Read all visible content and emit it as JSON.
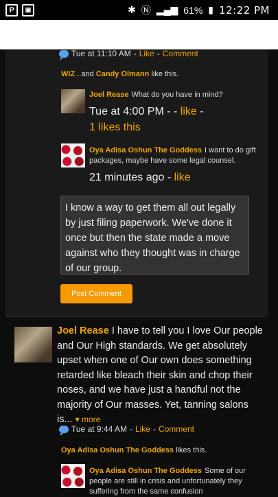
{
  "status_bar": {
    "time": "12:22 PM",
    "battery": "61%"
  },
  "comment_thread": {
    "post_meta": {
      "time": "Tue at 11:10 AM",
      "sep1": "-",
      "like": "Like",
      "sep2": "-",
      "comment": "Comment"
    },
    "post_likes": {
      "user1": "WIZ .",
      "and": "and",
      "user2": "Candy Olmann",
      "suffix": "like this."
    },
    "reply1": {
      "author": "Joel Rease",
      "text": "What do you have in mind?",
      "time": "Tue at 4:00 PM - - ",
      "like": "like",
      "likes_count": "1 likes this"
    },
    "reply2": {
      "author": "Oya Adisa Oshun The Goddess",
      "text": "I want to do gift packages, maybe have some legal counsel.",
      "time": "21 minutes ago - ",
      "like": "like"
    },
    "reply_box": {
      "value": "I know a way to get them all out legally by just filing paperwork. We've done it once but then the state made a move against who they thought was in charge of our group."
    },
    "post_button": "Post Comment"
  },
  "post2": {
    "author": "Joel Rease",
    "text": "I have to tell you I love Our people and Our High standards. We get absolutely upset when one of Our own does something retarded like bleach their skin and chop their noses, and we have just a handful not the majority of Our masses. Yet, tanning salons is...",
    "more": "more",
    "meta": {
      "time": "Tue at 9:44 AM",
      "sep1": "-",
      "like": "Like",
      "sep2": "-",
      "comment": "Comment"
    },
    "likes": {
      "user": "Oya Adisa Oshun The Goddess",
      "suffix": "likes this."
    },
    "reply": {
      "author": "Oya Adisa Oshun The Goddess",
      "text": "Some of our people are still in crisis and unfortunately they suffering from the same confusion"
    }
  }
}
